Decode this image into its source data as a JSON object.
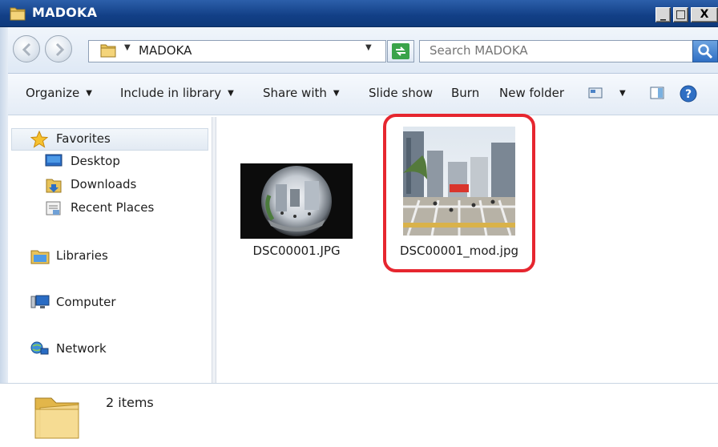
{
  "window": {
    "title": "MADOKA",
    "controls": {
      "minimize": "_",
      "maximize": "□",
      "close": "X"
    }
  },
  "address": {
    "breadcrumb": "MADOKA",
    "search_placeholder": "Search MADOKA"
  },
  "toolbar": {
    "organize": "Organize",
    "include_in_library": "Include in library",
    "share_with": "Share with",
    "slide_show": "Slide show",
    "burn": "Burn",
    "new_folder": "New folder"
  },
  "nav": {
    "favorites": "Favorites",
    "desktop": "Desktop",
    "downloads": "Downloads",
    "recent_places": "Recent Places",
    "libraries": "Libraries",
    "computer": "Computer",
    "network": "Network"
  },
  "files": [
    {
      "name": "DSC00001.JPG",
      "kind": "fisheye-photo"
    },
    {
      "name": "DSC00001_mod.jpg",
      "kind": "corrected-photo",
      "highlighted": true
    }
  ],
  "details": {
    "count_text": "2 items"
  },
  "colors": {
    "highlight_border": "#e6262f",
    "titlebar": "#123f86"
  }
}
